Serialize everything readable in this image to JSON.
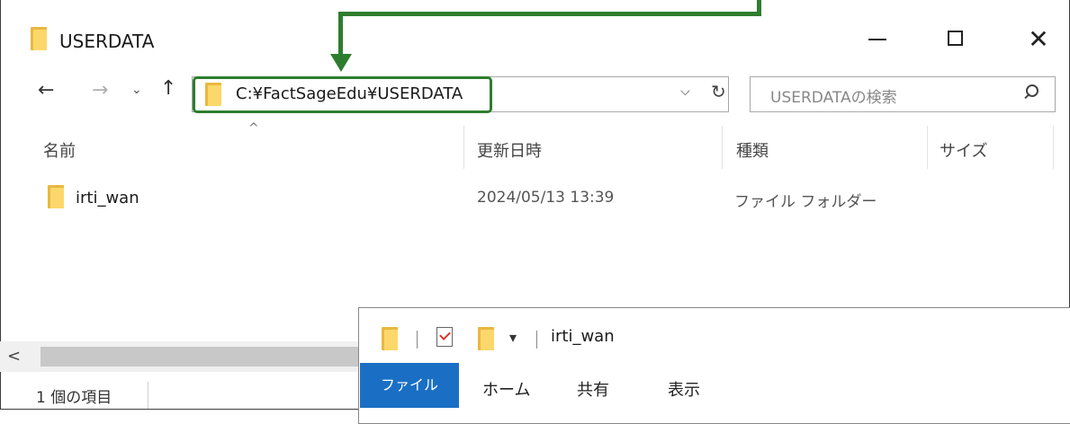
{
  "window": {
    "title": "USERDATA",
    "minimize_glyph": "",
    "close_glyph": "✕"
  },
  "nav": {
    "back_glyph": "←",
    "forward_glyph": "→",
    "recent_glyph": "⌄",
    "up_glyph": "↑",
    "address": "C:¥FactSageEdu¥USERDATA",
    "address_dropdown_glyph": "⌵",
    "refresh_glyph": "↻",
    "search_placeholder": "USERDATAの検索"
  },
  "columns": {
    "sort_glyph": "^",
    "name": "名前",
    "date": "更新日時",
    "type": "種類",
    "size": "サイズ"
  },
  "rows": [
    {
      "name": "irti_wan",
      "date": "2024/05/13 13:39",
      "type": "ファイル フォルダー",
      "size": ""
    }
  ],
  "scrollbar": {
    "left_glyph": "<"
  },
  "status": {
    "count_text": "1 個の項目"
  },
  "window2": {
    "title": "irti_wan",
    "qat_dropdown_glyph": "▾",
    "tabs": {
      "file": "ファイル",
      "home": "ホーム",
      "share": "共有",
      "view": "表示"
    }
  },
  "colors": {
    "annotation": "#2e7d2e",
    "file_tab": "#1a6fc4",
    "folder": "#fcd76b"
  }
}
